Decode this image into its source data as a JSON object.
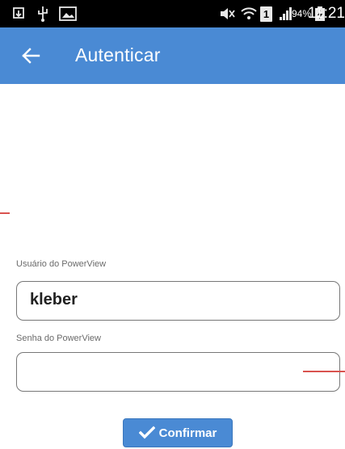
{
  "status_bar": {
    "icons": [
      "download-icon",
      "usb-icon",
      "image-icon",
      "mute-icon",
      "wifi-icon",
      "sim-icon",
      "signal-icon",
      "battery-icon"
    ],
    "sim_number": "1",
    "battery_percent": "94%",
    "time": "11:21"
  },
  "app_bar": {
    "title": "Autenticar",
    "color": "#4a8ad4"
  },
  "form": {
    "user_label": "Usuário do PowerView",
    "user_value": "kleber",
    "password_label": "Senha do PowerView",
    "password_value": "",
    "confirm_label": "Confirmar"
  }
}
